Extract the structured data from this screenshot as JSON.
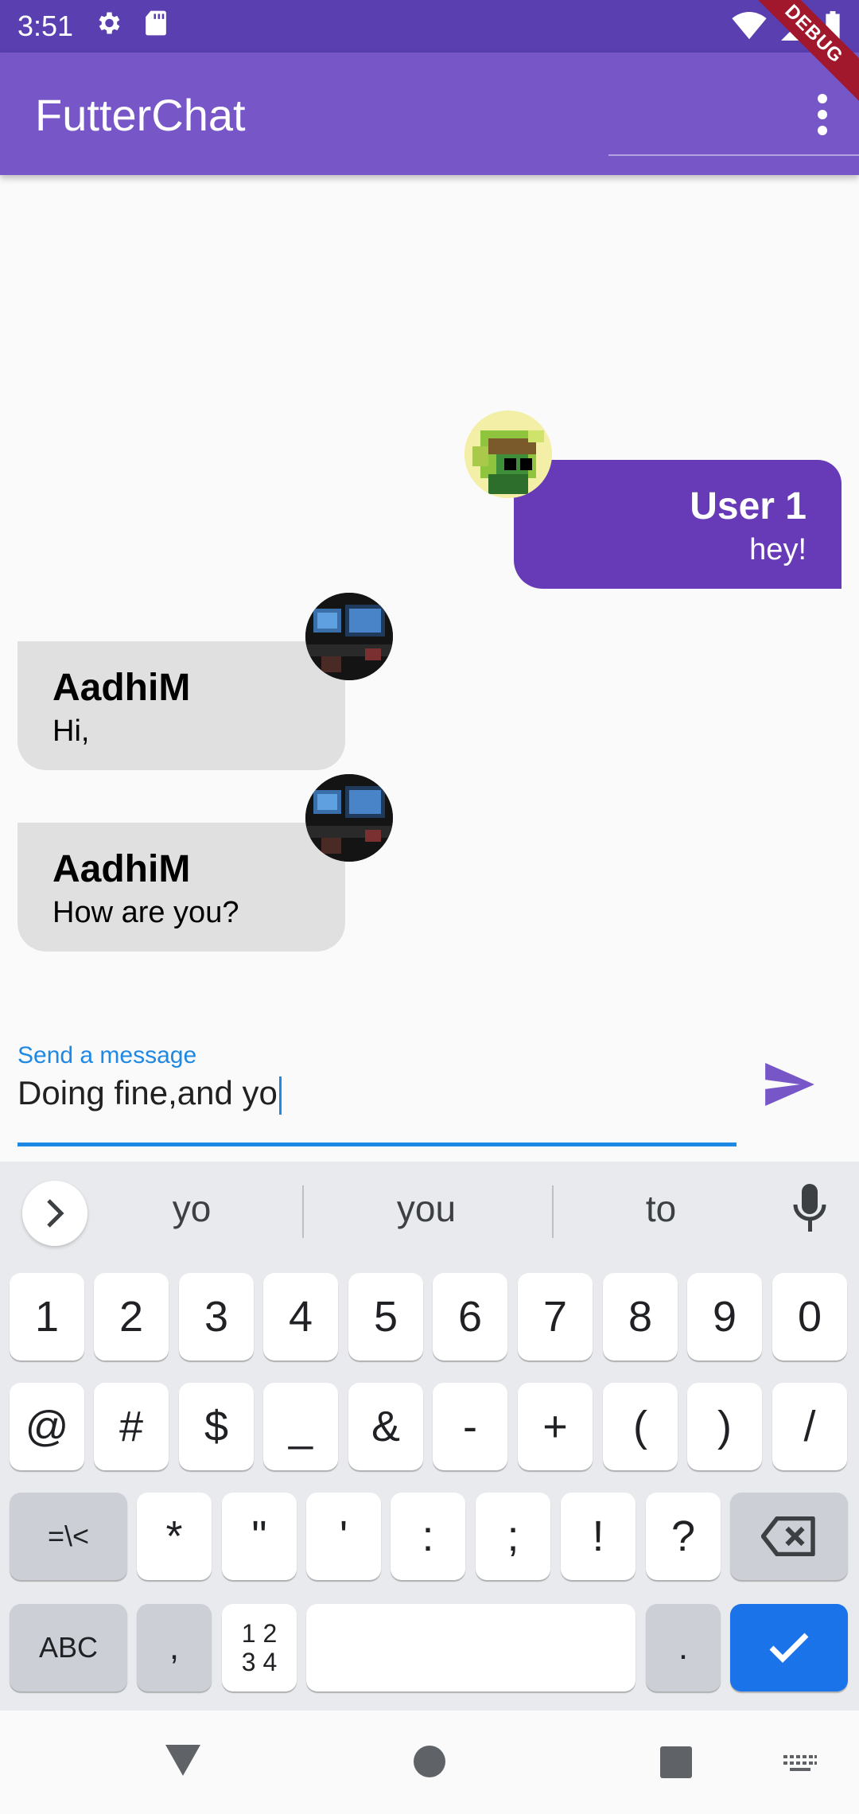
{
  "status_bar": {
    "time": "3:51"
  },
  "debug_banner": "DEBUG",
  "app_bar": {
    "title": "FutterChat"
  },
  "messages": [
    {
      "sender": "User 1",
      "text": "hey!",
      "mine": true
    },
    {
      "sender": "AadhiM",
      "text": "Hi,",
      "mine": false
    },
    {
      "sender": "AadhiM",
      "text": "How are you?",
      "mine": false
    }
  ],
  "composer": {
    "label": "Send a message",
    "value": "Doing fine,and yo",
    "accent_color": "#1e88e5"
  },
  "keyboard": {
    "suggestions": [
      "yo",
      "you",
      "to"
    ],
    "rows": [
      [
        "1",
        "2",
        "3",
        "4",
        "5",
        "6",
        "7",
        "8",
        "9",
        "0"
      ],
      [
        "@",
        "#",
        "$",
        "_",
        "&",
        "-",
        "+",
        "(",
        ")",
        "/"
      ],
      [
        "=\\<",
        "*",
        "\"",
        "'",
        ":",
        ";",
        "!",
        "?"
      ],
      [
        "ABC",
        ",",
        "12\n34",
        ".",
        ""
      ]
    ],
    "mod_key": "=\\<",
    "abc_key": "ABC",
    "comma_key": ",",
    "numpad_key_top": "1 2",
    "numpad_key_bottom": "3 4",
    "period_key": "."
  },
  "colors": {
    "status_bar": "#5a3fb0",
    "app_bar": "#7756c7",
    "my_bubble": "#673ab7",
    "other_bubble": "#e0e0e0",
    "send_icon": "#7756c7",
    "action_key": "#1a73e8"
  }
}
